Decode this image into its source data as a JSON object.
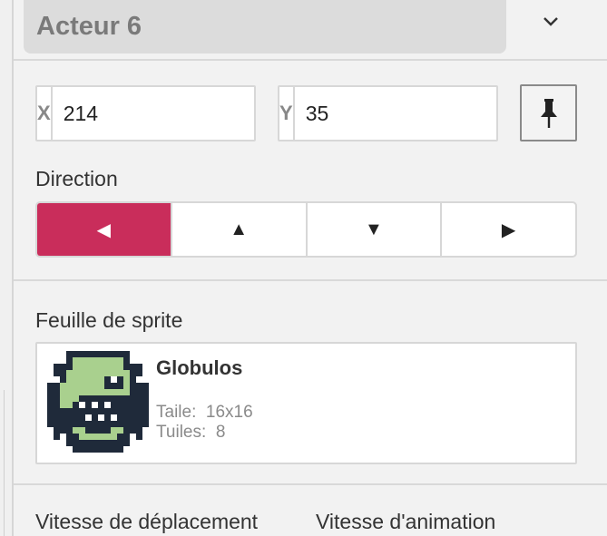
{
  "header": {
    "title": "Acteur 6",
    "collapse_icon": "chevron-down-icon"
  },
  "coords": {
    "x_label": "X",
    "x_value": "214",
    "y_label": "Y",
    "y_value": "35",
    "pin_icon": "pin-icon"
  },
  "direction": {
    "label": "Direction",
    "buttons": [
      {
        "name": "left",
        "glyph": "◀",
        "active": true
      },
      {
        "name": "up",
        "glyph": "▲",
        "active": false
      },
      {
        "name": "down",
        "glyph": "▼",
        "active": false
      },
      {
        "name": "right",
        "glyph": "▶",
        "active": false
      }
    ],
    "active_color": "#c92d5b"
  },
  "sprite": {
    "section_label": "Feuille de sprite",
    "name": "Globulos",
    "size_label": "Taile:",
    "size_value": "16x16",
    "tiles_label": "Tuiles:",
    "tiles_value": "8"
  },
  "speeds": {
    "move_label": "Vitesse de déplacement",
    "anim_label": "Vitesse d'animation"
  }
}
